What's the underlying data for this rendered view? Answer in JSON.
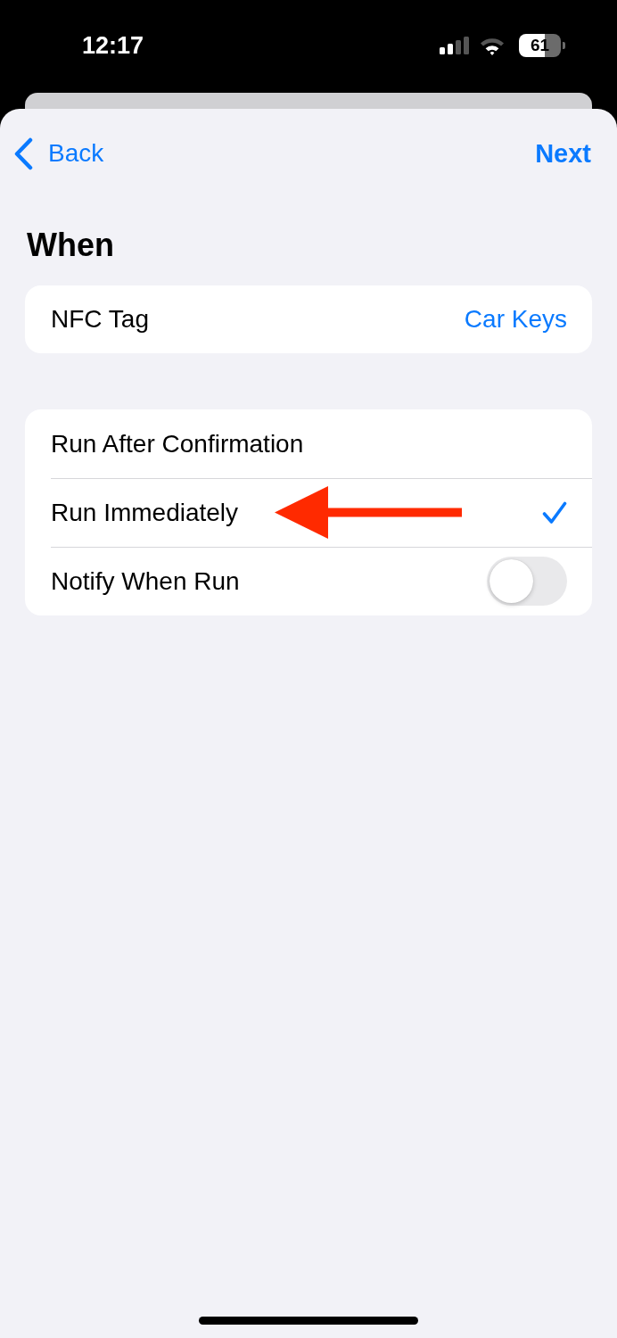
{
  "status_bar": {
    "time": "12:17",
    "battery": "61"
  },
  "navigation": {
    "back": "Back",
    "next": "Next"
  },
  "title": "When",
  "trigger": {
    "label": "NFC Tag",
    "value": "Car Keys"
  },
  "options": [
    {
      "kind": "choice",
      "label": "Run After Confirmation",
      "selected": false,
      "annotated": false
    },
    {
      "kind": "choice",
      "label": "Run Immediately",
      "selected": true,
      "annotated": true
    },
    {
      "kind": "toggle",
      "label": "Notify When Run",
      "on": false,
      "annotated": false
    }
  ]
}
